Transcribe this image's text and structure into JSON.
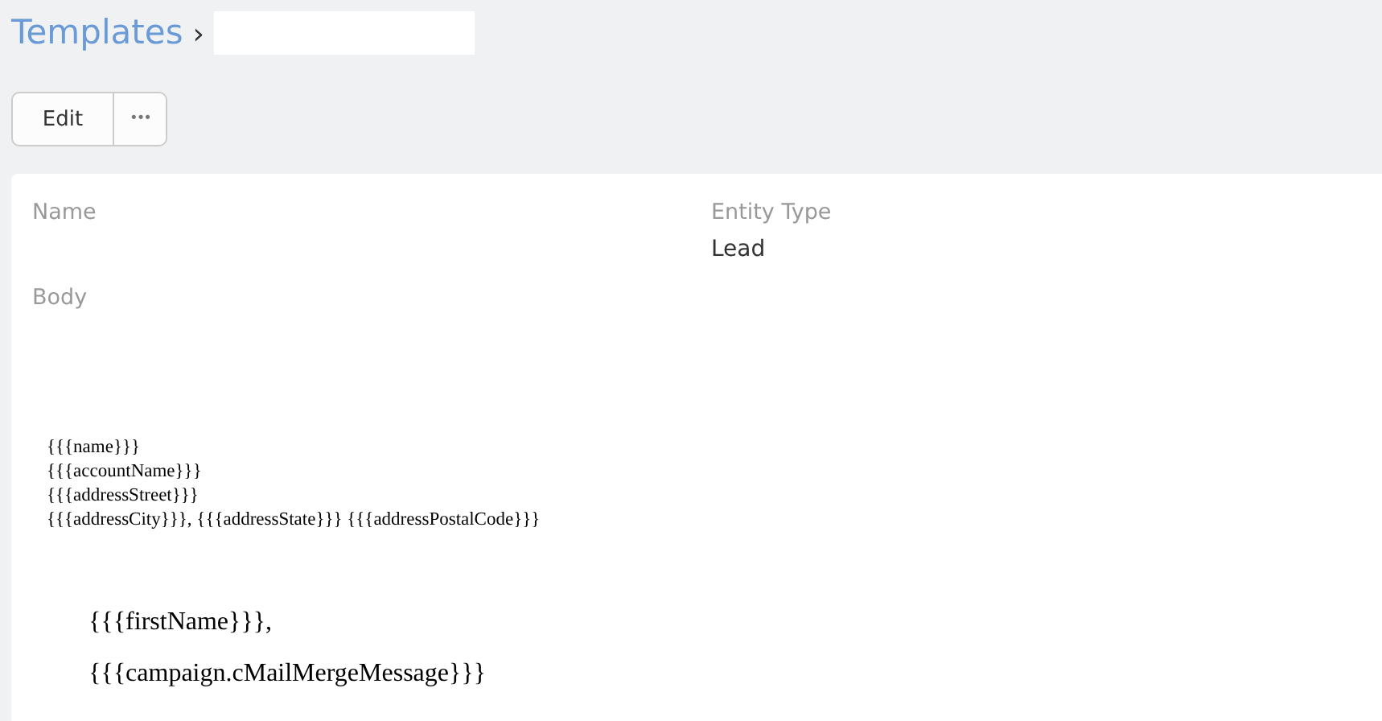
{
  "breadcrumb": {
    "link": "Templates",
    "separator": "›"
  },
  "buttons": [
    {
      "kind": "text",
      "label": "Edit"
    },
    {
      "kind": "more",
      "label": "•••"
    }
  ],
  "fields": [
    {
      "label": "Name"
    },
    {
      "label": "Entity Type",
      "value": "Lead"
    }
  ],
  "body": {
    "label": "Body",
    "address_lines": [
      "{{{name}}}",
      "{{{accountName}}}",
      "{{{addressStreet}}}",
      "{{{addressCity}}}, {{{addressState}}} {{{addressPostalCode}}}"
    ],
    "paragraphs": [
      "{{{firstName}}},",
      "{{{campaign.cMailMergeMessage}}}"
    ]
  }
}
